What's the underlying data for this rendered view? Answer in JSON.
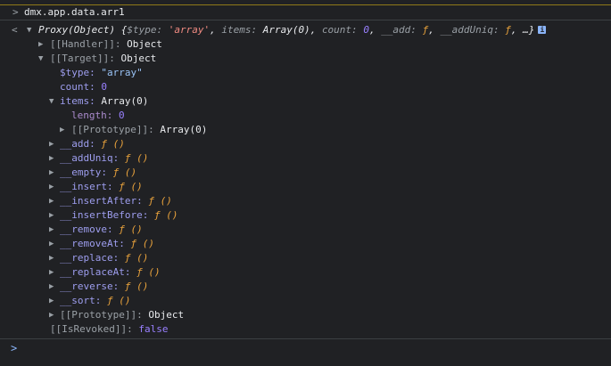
{
  "console": {
    "command": "dmx.app.data.arr1",
    "command_prompt": ">",
    "return_marker": "<",
    "summary": {
      "prefix": "Proxy(Object) {",
      "p1_key": "$type:",
      "p1_val": "'array'",
      "p2_key": "items:",
      "p2_val": "Array(0)",
      "p3_key": "count:",
      "p3_val": "0",
      "p4_key": "__add:",
      "p4_val": "ƒ",
      "p5_key": "__addUniq:",
      "p5_val": "ƒ",
      "suffix": "…}",
      "info_badge": "i"
    },
    "handler": {
      "key": "[[Handler]]:",
      "value": "Object"
    },
    "target": {
      "key": "[[Target]]:",
      "value": "Object"
    },
    "type_prop": {
      "key": "$type:",
      "value": "\"array\""
    },
    "count_prop": {
      "key": "count:",
      "value": "0"
    },
    "items_prop": {
      "key": "items:",
      "value": "Array(0)"
    },
    "length_prop": {
      "key": "length:",
      "value": "0"
    },
    "items_proto": {
      "key": "[[Prototype]]:",
      "value": "Array(0)"
    },
    "methods": [
      {
        "key": "__add:",
        "value": "ƒ ()"
      },
      {
        "key": "__addUniq:",
        "value": "ƒ ()"
      },
      {
        "key": "__empty:",
        "value": "ƒ ()"
      },
      {
        "key": "__insert:",
        "value": "ƒ ()"
      },
      {
        "key": "__insertAfter:",
        "value": "ƒ ()"
      },
      {
        "key": "__insertBefore:",
        "value": "ƒ ()"
      },
      {
        "key": "__remove:",
        "value": "ƒ ()"
      },
      {
        "key": "__removeAt:",
        "value": "ƒ ()"
      },
      {
        "key": "__replace:",
        "value": "ƒ ()"
      },
      {
        "key": "__replaceAt:",
        "value": "ƒ ()"
      },
      {
        "key": "__reverse:",
        "value": "ƒ ()"
      },
      {
        "key": "__sort:",
        "value": "ƒ ()"
      }
    ],
    "target_proto": {
      "key": "[[Prototype]]:",
      "value": "Object"
    },
    "revoked": {
      "key": "[[IsRevoked]]:",
      "value": "false"
    },
    "input_prompt": ">"
  },
  "icons": {
    "collapsed": "chevron-right-icon",
    "expanded": "chevron-down-icon"
  },
  "colors": {
    "background": "#202124",
    "key": "#9e9eef",
    "string": "#f28b82",
    "number": "#9980ff",
    "function": "#e8a23c"
  }
}
